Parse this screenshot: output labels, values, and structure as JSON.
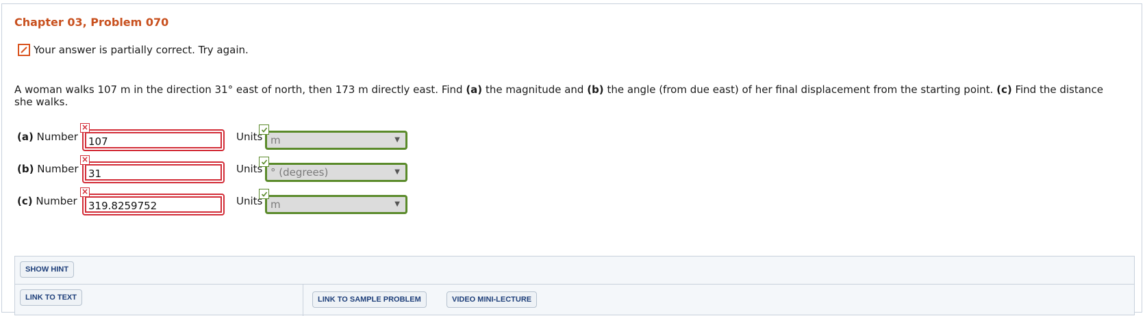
{
  "title": "Chapter 03, Problem 070",
  "feedback": {
    "icon": "pencil-icon",
    "text": "Your answer is partially correct.  Try again."
  },
  "question": {
    "part1": "A woman walks 107 m in the direction 31° east of north, then 173 m directly east. Find ",
    "a": "(a)",
    "part2": " the magnitude and ",
    "b": "(b)",
    "part3": " the angle (from due east) of her final displacement from the starting point. ",
    "c": "(c)",
    "part4": " Find the distance she walks."
  },
  "answers": [
    {
      "letter": "(a)",
      "number_label": "Number",
      "value": "107",
      "units_label": "Units",
      "unit": "m",
      "number_status": "incorrect",
      "unit_status": "correct"
    },
    {
      "letter": "(b)",
      "number_label": "Number",
      "value": "31",
      "units_label": "Units",
      "unit": "° (degrees)",
      "number_status": "incorrect",
      "unit_status": "correct"
    },
    {
      "letter": "(c)",
      "number_label": "Number",
      "value": "319.8259752",
      "units_label": "Units",
      "unit": "m",
      "number_status": "incorrect",
      "unit_status": "correct"
    }
  ],
  "buttons": {
    "show_hint": "SHOW HINT",
    "link_to_text": "LINK TO TEXT",
    "link_to_sample_problem": "LINK TO SAMPLE PROBLEM",
    "video_mini_lecture": "VIDEO MINI-LECTURE"
  },
  "colors": {
    "title": "#c8501e",
    "incorrect": "#d22b36",
    "correct": "#5a8a2a",
    "button_text": "#1e3f7a"
  }
}
